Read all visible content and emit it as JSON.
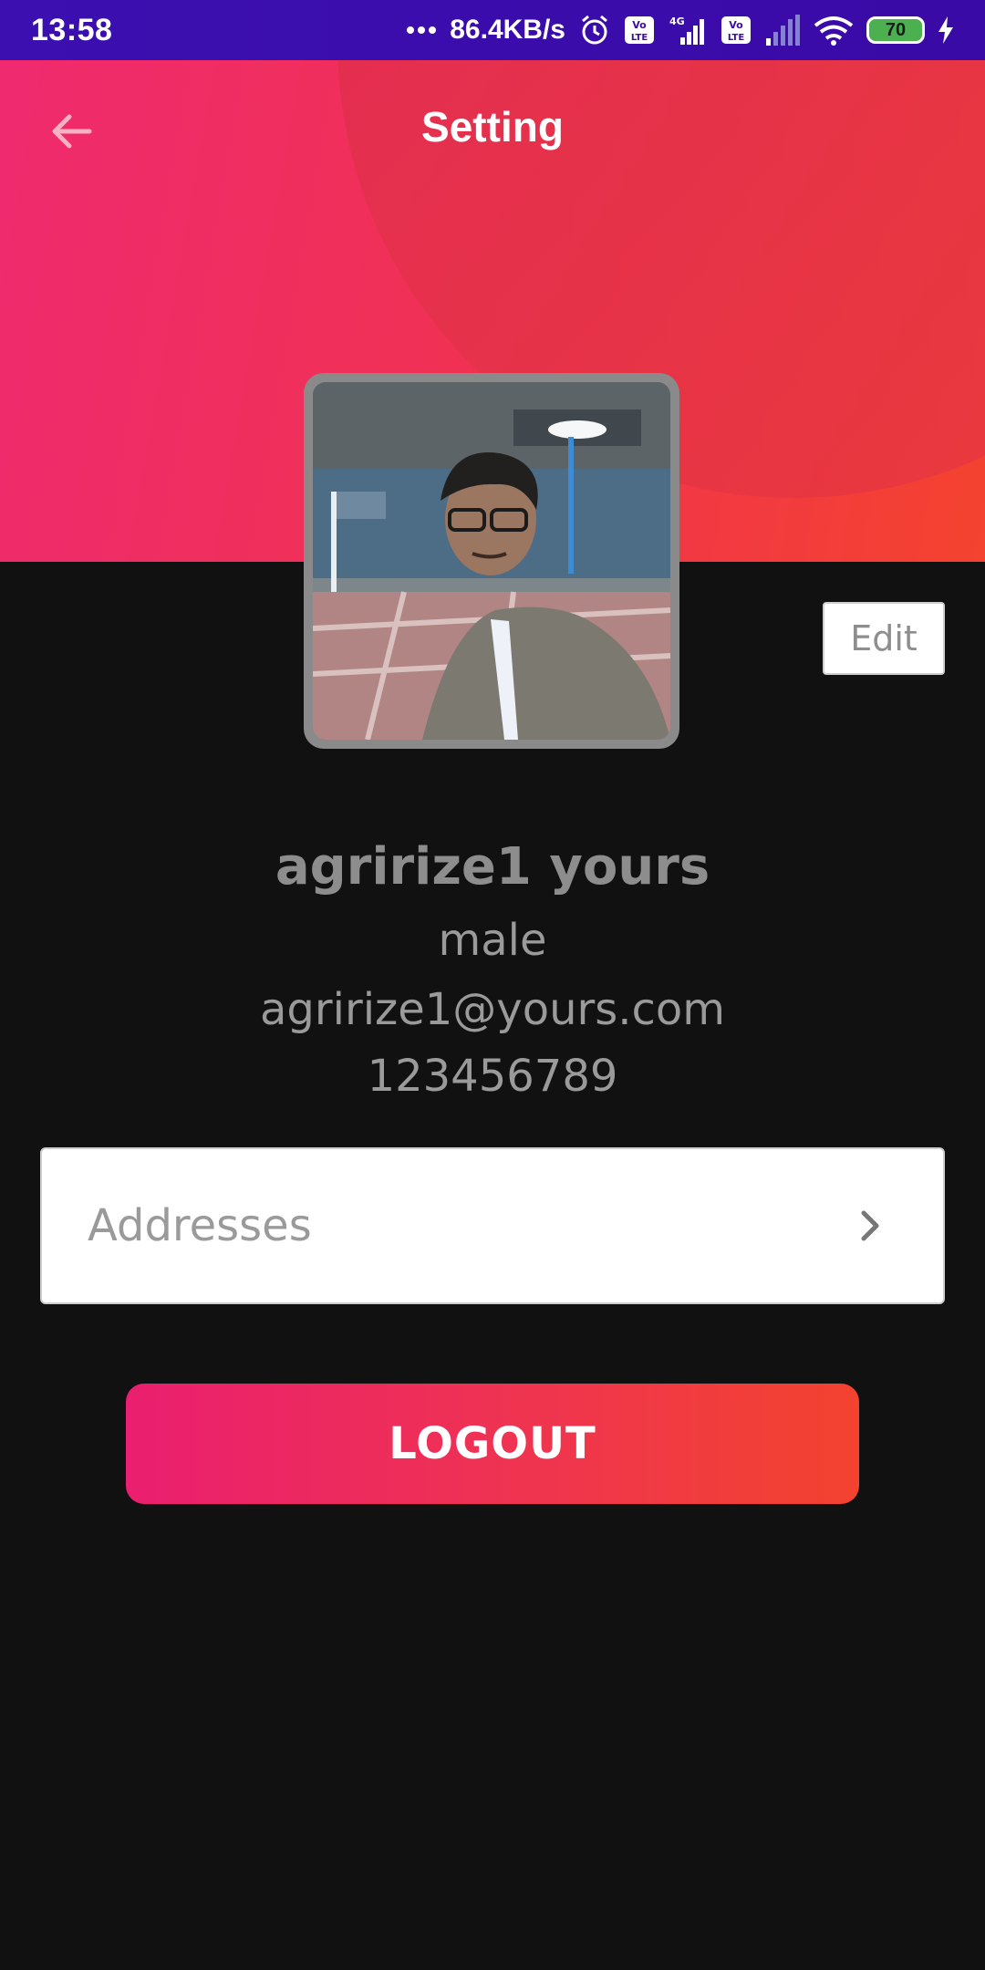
{
  "status_bar": {
    "time": "13:58",
    "network_speed": "86.4KB/s",
    "battery_level": "70",
    "icons": [
      "dots-icon",
      "alarm-icon",
      "volte-icon",
      "signal-4g-icon",
      "volte-icon",
      "signal-icon",
      "wifi-icon",
      "battery-icon",
      "charging-icon"
    ]
  },
  "header": {
    "title": "Setting",
    "back_icon": "arrow-left-icon"
  },
  "profile": {
    "edit_label": "Edit",
    "name": "agririze1 yours",
    "gender": "male",
    "email": "agririze1@yours.com",
    "phone": "123456789"
  },
  "menu": {
    "addresses_label": "Addresses",
    "chevron_icon": "chevron-right-icon"
  },
  "actions": {
    "logout_label": "LOGOUT"
  },
  "colors": {
    "status_bar": "#3a0ca3",
    "gradient_start": "#ef2a6f",
    "gradient_end": "#f4432f",
    "background": "#111111",
    "text_muted": "#9a9a9a"
  }
}
